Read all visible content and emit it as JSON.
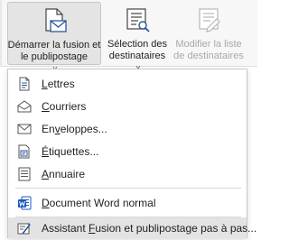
{
  "ribbon": {
    "start_merge": {
      "line1": "Démarrer la fusion et",
      "line2": "le publipostage",
      "chevron": "˅",
      "icon": "document-envelope-icon"
    },
    "select_recipients": {
      "line1": "Sélection des",
      "line2": "destinataires",
      "chevron": "˅",
      "icon": "recipient-list-icon"
    },
    "edit_recipients": {
      "line1": "Modifier la liste",
      "line2": "de destinataires",
      "icon": "edit-list-icon",
      "disabled": true
    }
  },
  "menu": {
    "items": [
      {
        "pre": "",
        "key": "L",
        "post": "ettres",
        "icon": "letter-document-icon"
      },
      {
        "pre": "",
        "key": "C",
        "post": "ourriers",
        "icon": "email-message-icon"
      },
      {
        "pre": "En",
        "key": "v",
        "post": "eloppes...",
        "icon": "envelope-icon"
      },
      {
        "pre": "",
        "key": "É",
        "post": "tiquettes...",
        "icon": "label-icon"
      },
      {
        "pre": "",
        "key": "A",
        "post": "nnuaire",
        "icon": "directory-icon"
      },
      {
        "pre": "",
        "key": "D",
        "post": "ocument Word normal",
        "icon": "word-document-icon"
      },
      {
        "pre": "Assistant ",
        "key": "F",
        "post": "usion et publipostage pas à pas...",
        "icon": "wizard-icon",
        "highlighted": true
      }
    ]
  },
  "colors": {
    "accent_blue": "#2b579a",
    "word_blue": "#185abd",
    "highlight": "#e3e3e3"
  }
}
